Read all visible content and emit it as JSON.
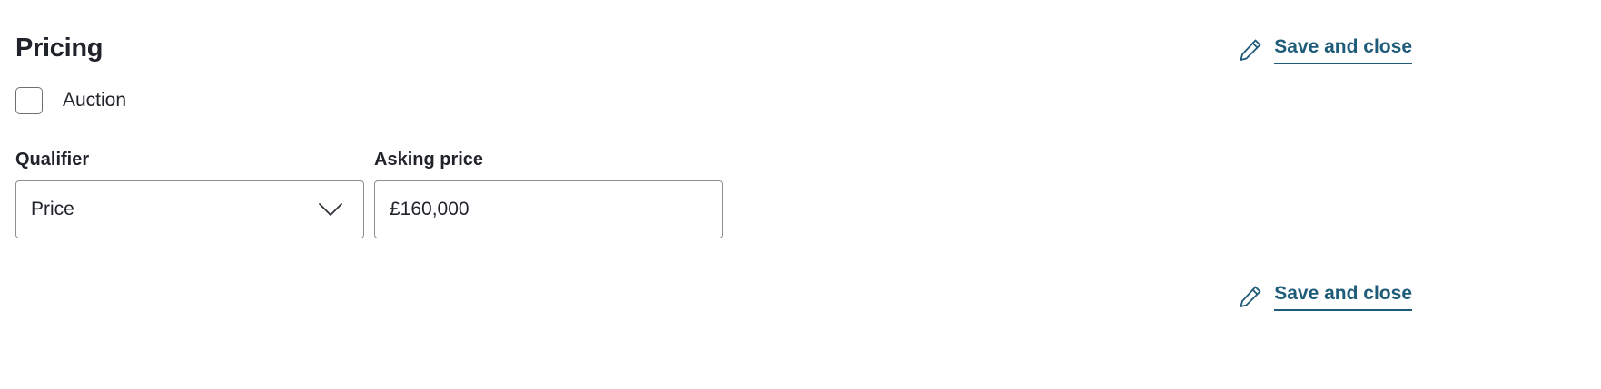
{
  "section": {
    "title": "Pricing"
  },
  "actions": {
    "save_and_close_label": "Save and close",
    "icon": "pencil-icon",
    "color": "#1e5c7a"
  },
  "auction": {
    "label": "Auction",
    "checked": false
  },
  "qualifier": {
    "label": "Qualifier",
    "selected_value": "Price",
    "icon": "chevron-down-icon"
  },
  "asking_price": {
    "label": "Asking price",
    "value": "£160,000"
  }
}
